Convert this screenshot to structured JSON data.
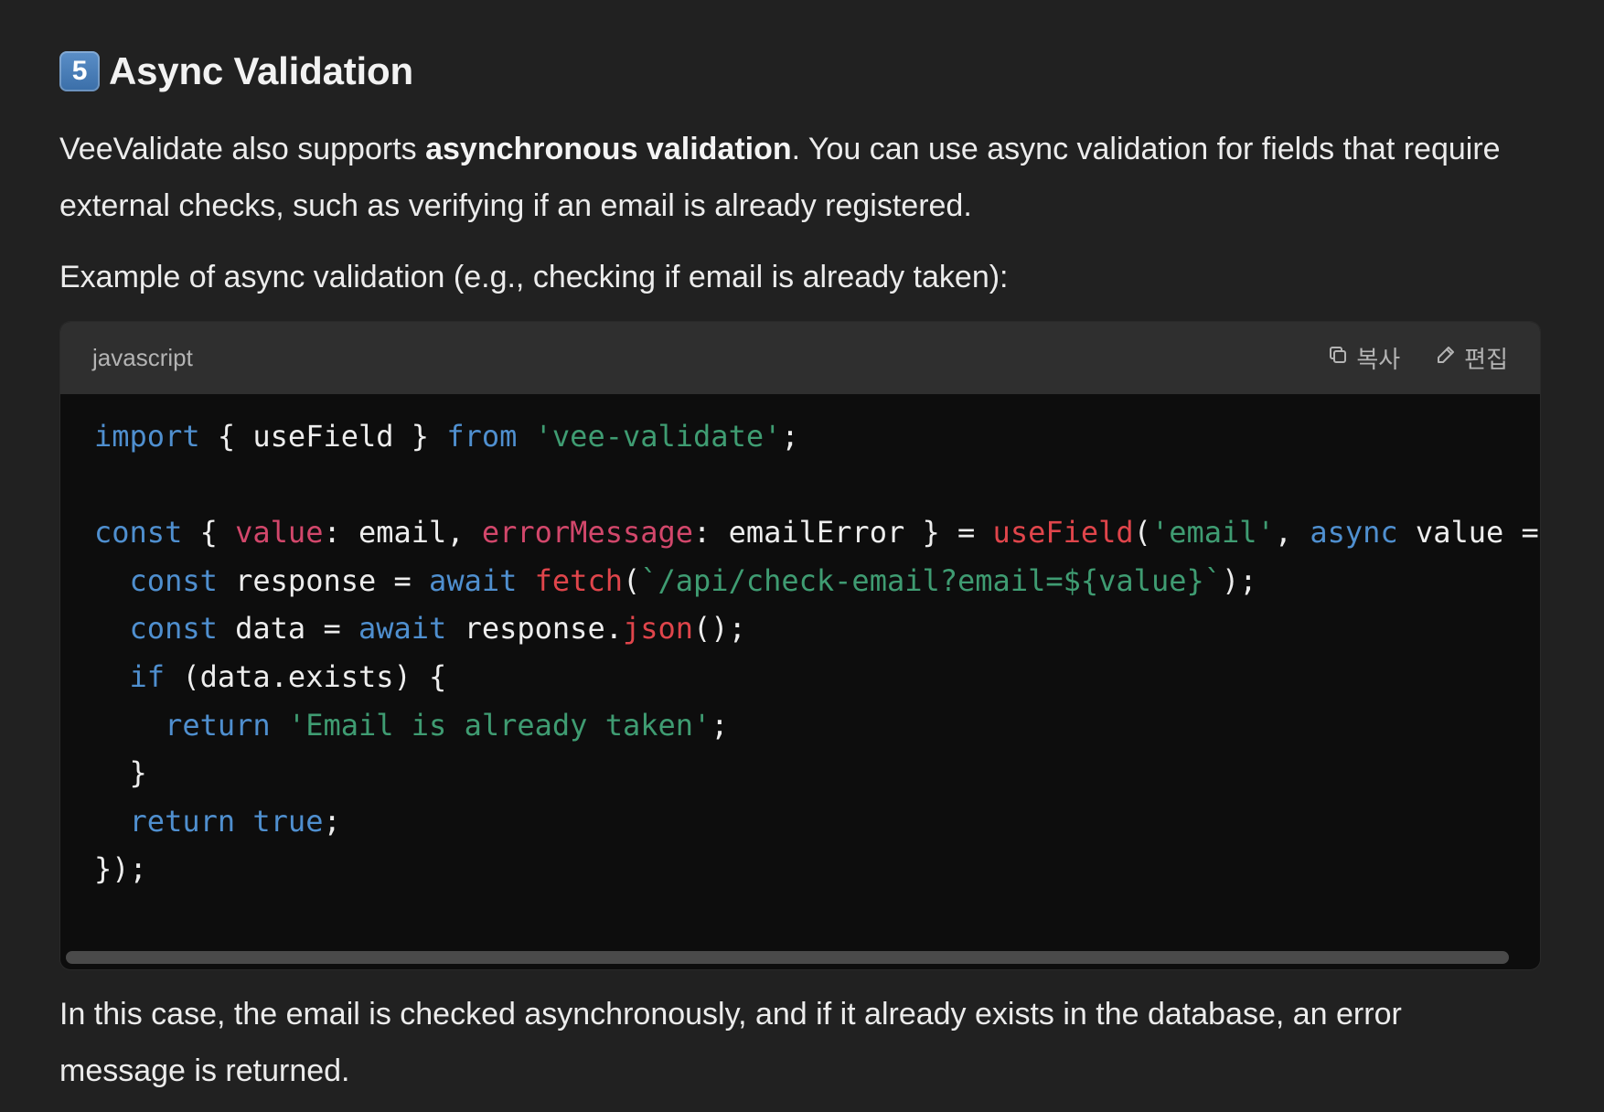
{
  "heading": {
    "number_badge": "5",
    "title": "Async Validation"
  },
  "intro": {
    "text_before": "VeeValidate also supports ",
    "bold": "asynchronous validation",
    "text_after": ". You can use async validation for fields that require external checks, such as verifying if an email is already registered."
  },
  "example_caption": "Example of async validation (e.g., checking if email is already taken):",
  "code_block": {
    "language": "javascript",
    "copy_label": "복사",
    "edit_label": "편집",
    "copy_icon": "copy-icon",
    "edit_icon": "pencil-icon",
    "lines": [
      "import { useField } from 'vee-validate';",
      "",
      "const { value: email, errorMessage: emailError } = useField('email', async value => {",
      "  const response = await fetch(`/api/check-email?email=${value}`);",
      "  const data = await response.json();",
      "  if (data.exists) {",
      "    return 'Email is already taken';",
      "  }",
      "  return true;",
      "});"
    ]
  },
  "conclusion": "In this case, the email is checked asynchronously, and if it already exists in the database, an error message is returned.",
  "colors": {
    "background": "#212121",
    "code_background": "#0d0d0d",
    "code_header": "#2f2f2f",
    "keyword": "#4f8fcf",
    "string": "#3f9c72",
    "property": "#d2476b",
    "function": "#e0454b"
  }
}
